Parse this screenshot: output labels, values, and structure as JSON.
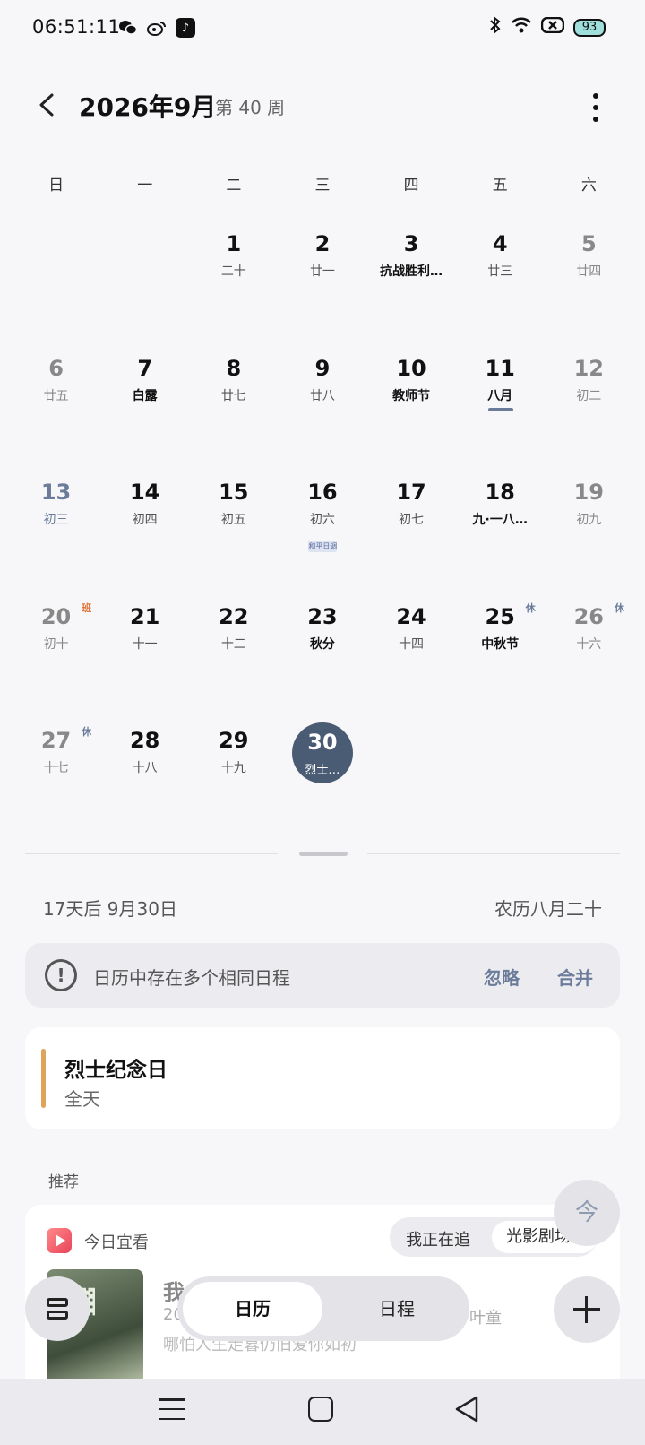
{
  "status_bar": {
    "time": "06:51:11",
    "apps": [
      "wechat-icon",
      "weibo-icon",
      "tiktok-icon"
    ],
    "battery": "93"
  },
  "header": {
    "title": "2026年9月",
    "week_label": "第 40 周"
  },
  "weekdays": [
    "日",
    "一",
    "二",
    "三",
    "四",
    "五",
    "六"
  ],
  "calendar": {
    "weeks": [
      [
        {
          "num": "",
          "sub": ""
        },
        {
          "num": "",
          "sub": ""
        },
        {
          "num": "1",
          "sub": "二十"
        },
        {
          "num": "2",
          "sub": "廿一"
        },
        {
          "num": "3",
          "sub": "抗战胜利…",
          "bold": true
        },
        {
          "num": "4",
          "sub": "廿三"
        },
        {
          "num": "5",
          "sub": "廿四",
          "weekend": true
        }
      ],
      [
        {
          "num": "6",
          "sub": "廿五",
          "weekend": true
        },
        {
          "num": "7",
          "sub": "白露",
          "bold": true
        },
        {
          "num": "8",
          "sub": "廿七"
        },
        {
          "num": "9",
          "sub": "廿八"
        },
        {
          "num": "10",
          "sub": "教师节",
          "bold": true
        },
        {
          "num": "11",
          "sub": "八月",
          "bold": true,
          "today": true
        },
        {
          "num": "12",
          "sub": "初二",
          "weekend": true
        }
      ],
      [
        {
          "num": "13",
          "sub": "初三",
          "blue": true
        },
        {
          "num": "14",
          "sub": "初四"
        },
        {
          "num": "15",
          "sub": "初五"
        },
        {
          "num": "16",
          "sub": "初六",
          "mini_event": "和平日调"
        },
        {
          "num": "17",
          "sub": "初七"
        },
        {
          "num": "18",
          "sub": "九·一八…",
          "bold": true
        },
        {
          "num": "19",
          "sub": "初九",
          "weekend": true
        }
      ],
      [
        {
          "num": "20",
          "sub": "初十",
          "weekend": true,
          "tag": "班",
          "tag_type": "work"
        },
        {
          "num": "21",
          "sub": "十一"
        },
        {
          "num": "22",
          "sub": "十二"
        },
        {
          "num": "23",
          "sub": "秋分",
          "bold": true
        },
        {
          "num": "24",
          "sub": "十四"
        },
        {
          "num": "25",
          "sub": "中秋节",
          "bold": true,
          "tag": "休",
          "tag_type": "rest"
        },
        {
          "num": "26",
          "sub": "十六",
          "weekend": true,
          "tag": "休",
          "tag_type": "rest"
        }
      ],
      [
        {
          "num": "27",
          "sub": "十七",
          "weekend": true,
          "tag": "休",
          "tag_type": "rest"
        },
        {
          "num": "28",
          "sub": "十八"
        },
        {
          "num": "29",
          "sub": "十九"
        },
        {
          "num": "30",
          "sub": "烈士…",
          "selected": true
        },
        {
          "num": "",
          "sub": ""
        },
        {
          "num": "",
          "sub": ""
        },
        {
          "num": "",
          "sub": ""
        }
      ]
    ]
  },
  "info": {
    "relative_date": "17天后  9月30日",
    "lunar": "农历八月二十"
  },
  "banner": {
    "text": "日历中存在多个相同日程",
    "ignore": "忽略",
    "merge": "合并"
  },
  "event": {
    "title": "烈士纪念日",
    "time": "全天",
    "color": "#e0a35a"
  },
  "recommend": {
    "section_label": "推荐",
    "app_name": "今日宜看",
    "tab_following": "我正在追",
    "tab_drama": "光影剧场",
    "title": "我",
    "meta": "20",
    "meta2": "叶童",
    "desc": "哪怕人生走暮仍旧爱你如初"
  },
  "fab": {
    "today": "今"
  },
  "segment": {
    "calendar": "日历",
    "schedule": "日程"
  },
  "colors": {
    "accent": "#4a5b74",
    "link": "#6a7c99",
    "work_tag": "#e0753b"
  }
}
